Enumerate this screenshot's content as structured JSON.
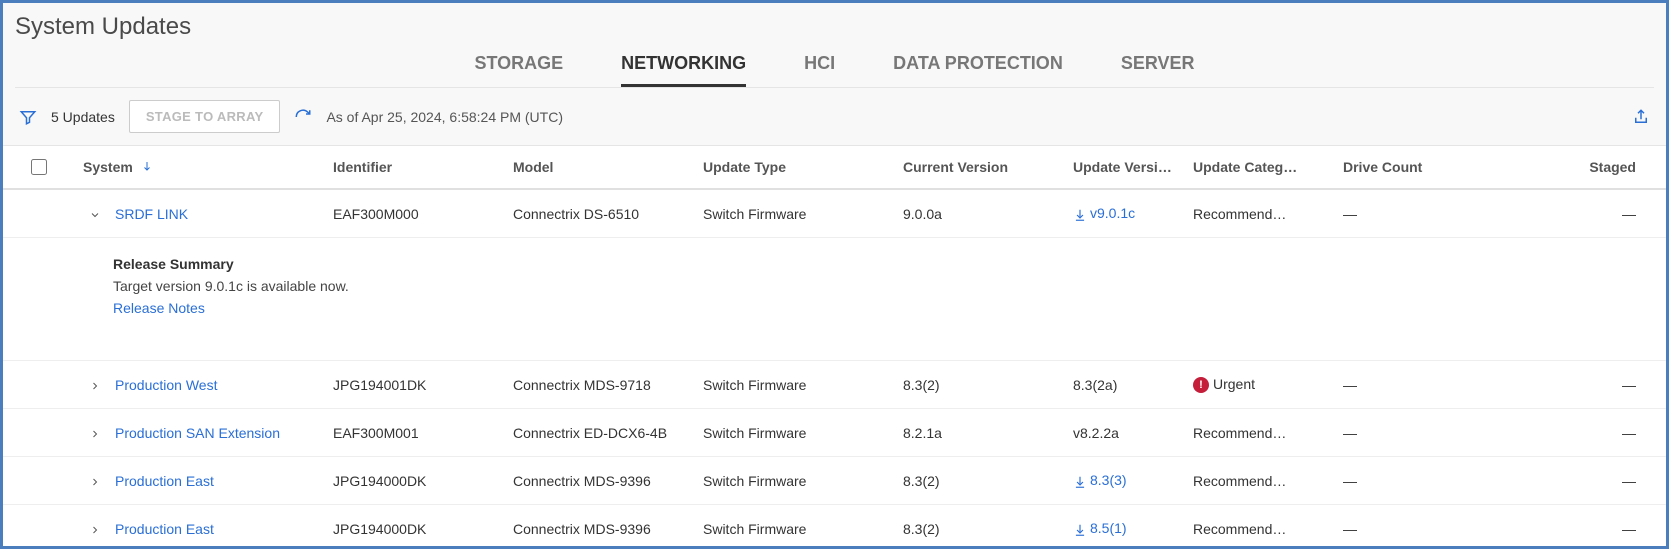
{
  "page": {
    "title": "System Updates"
  },
  "tabs": [
    {
      "label": "STORAGE",
      "active": false
    },
    {
      "label": "NETWORKING",
      "active": true
    },
    {
      "label": "HCI",
      "active": false
    },
    {
      "label": "DATA PROTECTION",
      "active": false
    },
    {
      "label": "SERVER",
      "active": false
    }
  ],
  "toolbar": {
    "updates_count": "5 Updates",
    "stage_button": "STAGE TO ARRAY",
    "timestamp": "As of Apr 25, 2024, 6:58:24 PM (UTC)"
  },
  "columns": {
    "system": "System",
    "identifier": "Identifier",
    "model": "Model",
    "update_type": "Update Type",
    "current_version": "Current Version",
    "update_version": "Update Version",
    "update_category": "Update Categ…",
    "drive_count": "Drive Count",
    "staged": "Staged"
  },
  "expand": {
    "title": "Release Summary",
    "body": "Target version 9.0.1c is available now.",
    "link": "Release Notes"
  },
  "rows": [
    {
      "expanded": true,
      "system": "SRDF LINK",
      "identifier": "EAF300M000",
      "model": "Connectrix DS-6510",
      "update_type": "Switch Firmware",
      "current_version": "9.0.0a",
      "update_version": "v9.0.1c",
      "update_version_download": true,
      "category_text": "Recommend…",
      "category_urgent": false,
      "drive_count": "—",
      "staged": "—"
    },
    {
      "expanded": false,
      "system": "Production West",
      "identifier": "JPG194001DK",
      "model": "Connectrix MDS-9718",
      "update_type": "Switch Firmware",
      "current_version": "8.3(2)",
      "update_version": "8.3(2a)",
      "update_version_download": false,
      "category_text": "Urgent",
      "category_urgent": true,
      "drive_count": "—",
      "staged": "—"
    },
    {
      "expanded": false,
      "system": "Production SAN Extension",
      "identifier": "EAF300M001",
      "model": "Connectrix ED-DCX6-4B",
      "update_type": "Switch Firmware",
      "current_version": "8.2.1a",
      "update_version": "v8.2.2a",
      "update_version_download": false,
      "category_text": "Recommend…",
      "category_urgent": false,
      "drive_count": "—",
      "staged": "—"
    },
    {
      "expanded": false,
      "system": "Production East",
      "identifier": "JPG194000DK",
      "model": "Connectrix MDS-9396",
      "update_type": "Switch Firmware",
      "current_version": "8.3(2)",
      "update_version": "8.3(3)",
      "update_version_download": true,
      "category_text": "Recommend…",
      "category_urgent": false,
      "drive_count": "—",
      "staged": "—"
    },
    {
      "expanded": false,
      "system": "Production East",
      "identifier": "JPG194000DK",
      "model": "Connectrix MDS-9396",
      "update_type": "Switch Firmware",
      "current_version": "8.3(2)",
      "update_version": "8.5(1)",
      "update_version_download": true,
      "category_text": "Recommend…",
      "category_urgent": false,
      "drive_count": "—",
      "staged": "—"
    }
  ]
}
